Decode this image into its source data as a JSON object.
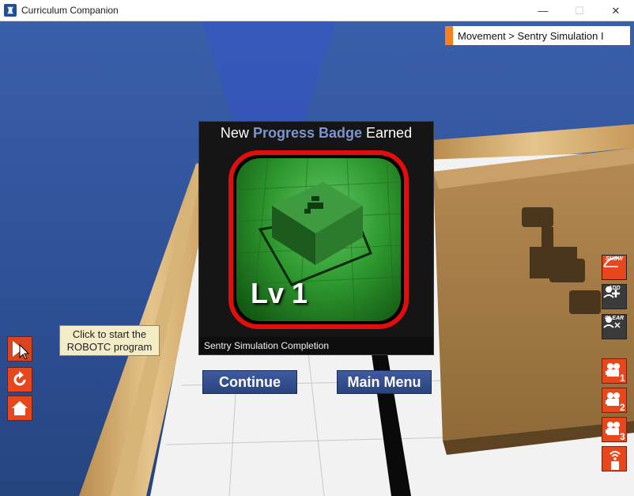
{
  "window": {
    "title": "Curriculum Companion",
    "controls": {
      "minimize": "—",
      "maximize": "☐",
      "close": "✕"
    }
  },
  "breadcrumb": {
    "text": "Movement > Sentry Simulation I"
  },
  "badge": {
    "heading_prefix": "New",
    "heading_highlight": "Progress Badge",
    "heading_suffix": "Earned",
    "level": "Lv 1",
    "caption": "Sentry Simulation Completion"
  },
  "buttons": {
    "continue": "Continue",
    "main_menu": "Main Menu"
  },
  "tooltip": {
    "line1": "Click to start the",
    "line2": "ROBOTC program"
  },
  "tools": {
    "show": "SHOW",
    "add": "ADD",
    "clear": "CLEAR"
  },
  "cameras": [
    "1",
    "2",
    "3"
  ],
  "colors": {
    "accent": "#e8461d",
    "badge_border": "#e10e0e",
    "button": "#2f4a8c",
    "highlight": "#7b95cf"
  }
}
